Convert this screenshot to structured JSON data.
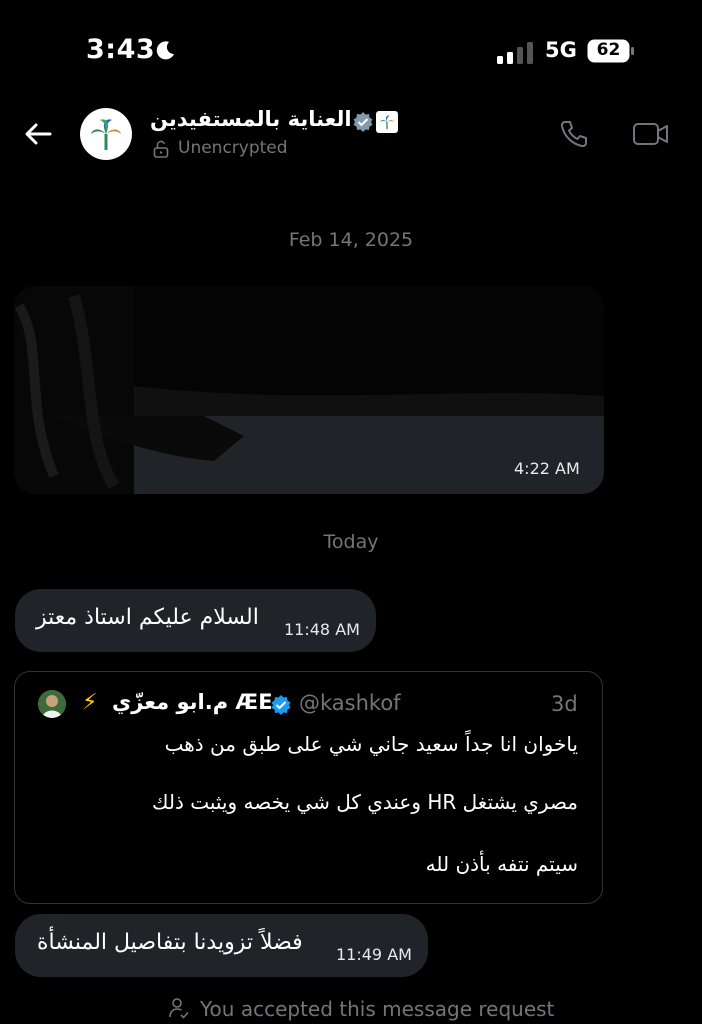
{
  "status_bar": {
    "time": "3:43",
    "network": "5G",
    "battery": "62"
  },
  "header": {
    "title": "العناية بالمستفيدين",
    "subtitle": "Unencrypted"
  },
  "conversation": {
    "date_1": "Feb 14, 2025",
    "redacted_message_time": "4:22 AM",
    "date_2": "Today",
    "message_1": {
      "text": "السلام عليكم استاذ معتز",
      "time": "11:48 AM"
    },
    "quoted_post": {
      "author_name": "م.ابو معزّي ÆE",
      "handle": "@kashkof",
      "age": "3d",
      "lines": [
        "ياخوان انا جداً سعيد جاني شي على طبق من ذهب",
        "مصري يشتغل HR وعندي كل شي يخصه ويثبت ذلك",
        "سيتم نتفه بأذن لله"
      ]
    },
    "message_2": {
      "text": "فضلاً تزويدنا بتفاصيل المنشأة",
      "time": "11:49 AM"
    },
    "system_notice": "You accepted this message request"
  },
  "colors": {
    "background": "#000000",
    "bubble": "#202327",
    "muted": "#71767b",
    "verified": "#1d9bf0"
  }
}
